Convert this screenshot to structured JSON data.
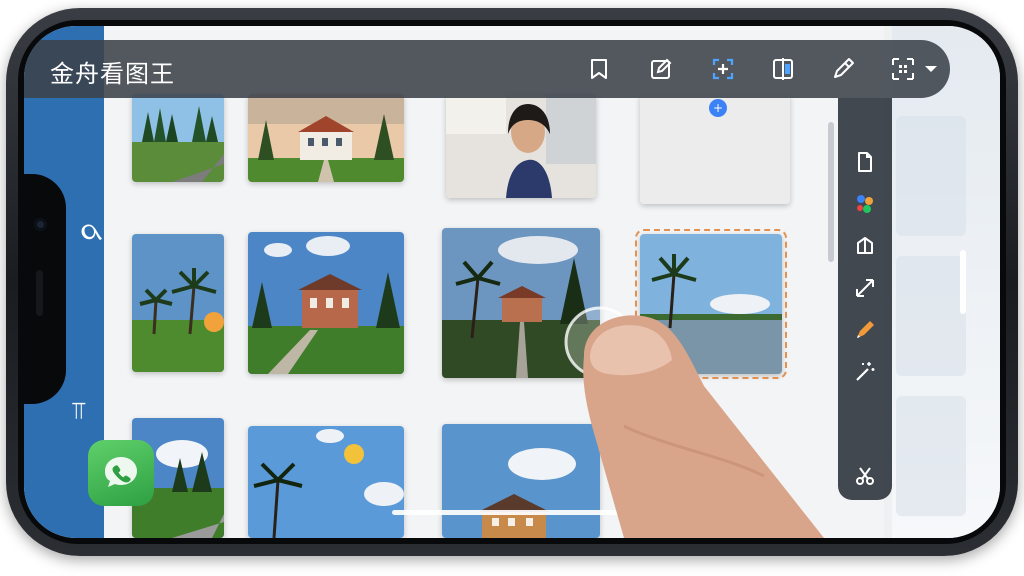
{
  "app": {
    "title": "金舟看图王"
  },
  "top_toolbar": {
    "buttons": [
      {
        "name": "bookmark-icon"
      },
      {
        "name": "edit-icon"
      },
      {
        "name": "add-frame-icon",
        "active": true
      },
      {
        "name": "compare-icon"
      },
      {
        "name": "pen-icon"
      },
      {
        "name": "qr-grid-icon"
      },
      {
        "name": "chevron-down-icon"
      }
    ]
  },
  "side_toolbar": {
    "buttons": [
      {
        "name": "file-icon"
      },
      {
        "name": "color-dots-icon"
      },
      {
        "name": "crop-icon"
      },
      {
        "name": "resize-arrow-icon"
      },
      {
        "name": "brush-icon"
      },
      {
        "name": "magic-wand-icon"
      },
      {
        "name": "cut-icon"
      }
    ]
  },
  "left_rail": {
    "digit": "ර"
  },
  "gallery": {
    "thumbnails": [
      {
        "name": "thumb-forest-road",
        "selected": false
      },
      {
        "name": "thumb-villa",
        "selected": false
      },
      {
        "name": "thumb-woman",
        "selected": false
      },
      {
        "name": "thumb-blank",
        "selected": false
      },
      {
        "name": "thumb-palm-sunset",
        "selected": false
      },
      {
        "name": "thumb-brick-house",
        "selected": false
      },
      {
        "name": "thumb-palm-path",
        "selected": false
      },
      {
        "name": "thumb-palm-lake",
        "selected": true
      },
      {
        "name": "thumb-clouds-forest",
        "selected": false
      },
      {
        "name": "thumb-palm-sun",
        "selected": false
      },
      {
        "name": "thumb-building-sky",
        "selected": false
      }
    ]
  },
  "colors": {
    "accent": "#3b82f6",
    "rail": "#2d6fb0",
    "selection": "#e29150",
    "toolbar_bg": "#3c424a"
  }
}
